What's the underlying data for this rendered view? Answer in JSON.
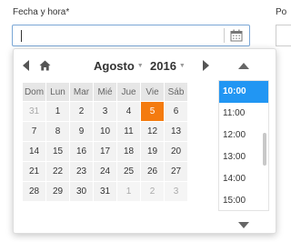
{
  "field": {
    "label": "Fecha y hora*",
    "value": "",
    "next_label": "Po"
  },
  "icons": {
    "calendar": "calendar-icon",
    "prev": "chevron-left-icon",
    "next": "chevron-right-icon",
    "home": "home-icon",
    "up": "chevron-up-icon",
    "down": "chevron-down-icon"
  },
  "calendar": {
    "month": "Agosto",
    "year": "2016",
    "weekdays": [
      "Dom",
      "Lun",
      "Mar",
      "Mié",
      "Jue",
      "Vie",
      "Sáb"
    ],
    "weeks": [
      [
        "31",
        "1",
        "2",
        "3",
        "4",
        "5",
        "6"
      ],
      [
        "7",
        "8",
        "9",
        "10",
        "11",
        "12",
        "13"
      ],
      [
        "14",
        "15",
        "16",
        "17",
        "18",
        "19",
        "20"
      ],
      [
        "21",
        "22",
        "23",
        "24",
        "25",
        "26",
        "27"
      ],
      [
        "28",
        "29",
        "30",
        "31",
        "1",
        "2",
        "3"
      ]
    ],
    "selected": "5"
  },
  "times": [
    "10:00",
    "11:00",
    "12:00",
    "13:00",
    "14:00",
    "15:00"
  ],
  "selected_time": "10:00",
  "colors": {
    "selected_day": "#f47b0f",
    "selected_time": "#2196f3",
    "input_border": "#7aa7d6"
  }
}
